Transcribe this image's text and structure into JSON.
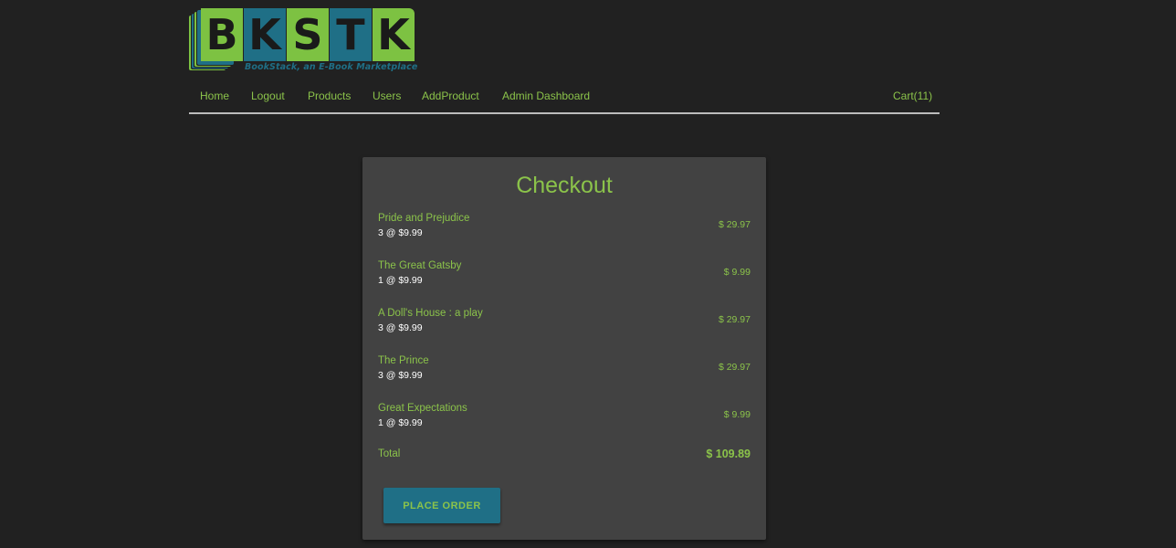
{
  "logo": {
    "letters": [
      "B",
      "K",
      "S",
      "T",
      "K"
    ],
    "tagline": "BookStack, an E-Book Marketplace",
    "colors": {
      "green": "#7dc242",
      "teal": "#1f6f86"
    }
  },
  "nav": {
    "home": "Home",
    "logout": "Logout",
    "products": "Products",
    "users": "Users",
    "add_product": "AddProduct",
    "admin_dashboard": "Admin Dashboard",
    "cart": "Cart(11)"
  },
  "checkout": {
    "title": "Checkout",
    "items": [
      {
        "name": "Pride and Prejudice",
        "qty": "3 @ $9.99",
        "price": "$ 29.97"
      },
      {
        "name": "The Great Gatsby",
        "qty": "1 @ $9.99",
        "price": "$ 9.99"
      },
      {
        "name": "A Doll's House : a play",
        "qty": "3 @ $9.99",
        "price": "$ 29.97"
      },
      {
        "name": "The Prince",
        "qty": "3 @ $9.99",
        "price": "$ 29.97"
      },
      {
        "name": "Great Expectations",
        "qty": "1 @ $9.99",
        "price": "$ 9.99"
      }
    ],
    "total_label": "Total",
    "total_value": "$ 109.89",
    "place_order": "PLACE ORDER"
  },
  "theme": {
    "background": "#212121",
    "card": "#424242",
    "accent": "#8bc34a",
    "button": "#1f6f86"
  }
}
